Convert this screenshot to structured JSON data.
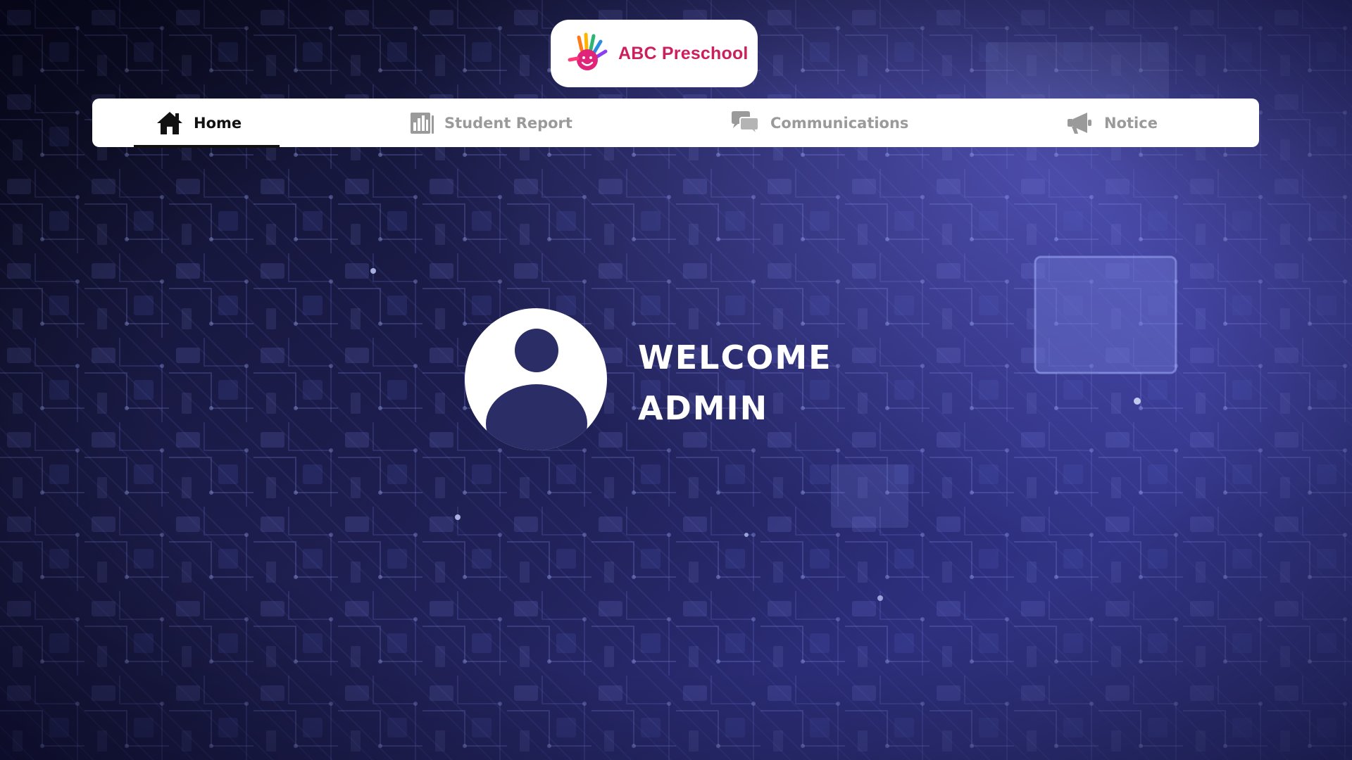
{
  "app": {
    "brand_name": "ABC Preschool",
    "brand_color": "#cc1f5c"
  },
  "nav": {
    "items": [
      {
        "label": "Home",
        "icon": "home-icon",
        "active": true
      },
      {
        "label": "Student Report",
        "icon": "report-icon",
        "active": false
      },
      {
        "label": "Communications",
        "icon": "chat-icon",
        "active": false
      },
      {
        "label": "Notice",
        "icon": "megaphone-icon",
        "active": false
      }
    ],
    "active_color": "#111111",
    "inactive_color": "#9a9a9a"
  },
  "welcome": {
    "line1": "WELCOME",
    "line2": "ADMIN",
    "avatar_icon": "user-icon"
  },
  "theme": {
    "background": "circuit-board",
    "accent": "#3a3d96"
  }
}
